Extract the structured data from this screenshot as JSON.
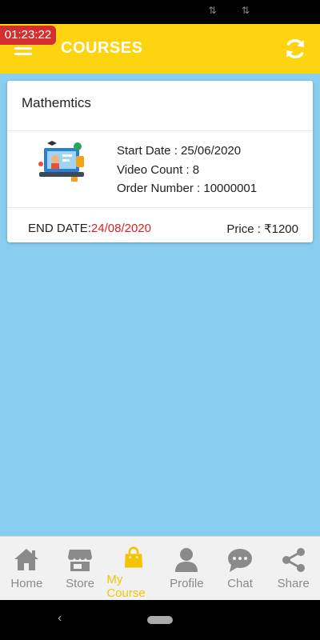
{
  "status": {
    "icons": "⇅ ⇅"
  },
  "timer": "01:23:22",
  "app_bar": {
    "title": "COURSES"
  },
  "colors": {
    "accent": "#fdd40f",
    "background": "#87cef0",
    "end_date": "#e01e1e"
  },
  "course": {
    "title": "Mathemtics",
    "start_date": "Start Date : 25/06/2020",
    "video_count": "Video Count : 8",
    "order_number": "Order Number : 10000001",
    "end_date_label": "END DATE:",
    "end_date_value": "24/08/2020",
    "price": "Price : ₹1200"
  },
  "nav": {
    "items": [
      {
        "label": "Home",
        "icon": "home-icon"
      },
      {
        "label": "Store",
        "icon": "store-icon"
      },
      {
        "label": "My Course",
        "icon": "shopping-bag-icon"
      },
      {
        "label": "Profile",
        "icon": "person-icon"
      },
      {
        "label": "Chat",
        "icon": "chat-icon"
      },
      {
        "label": "Share",
        "icon": "share-icon"
      }
    ]
  },
  "system_nav": {
    "back_glyph": "‹"
  }
}
